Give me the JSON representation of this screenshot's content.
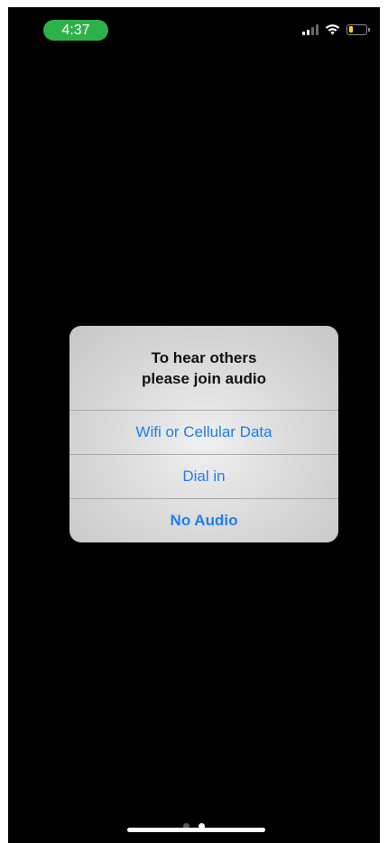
{
  "status_bar": {
    "time": "4:37",
    "icons": [
      "signal-icon",
      "wifi-icon",
      "battery-icon"
    ],
    "battery_level": 0.25,
    "colors": {
      "time_pill": "#2fb14a",
      "battery_fill": "#ffd60a"
    }
  },
  "alert": {
    "title_line1": "To hear others",
    "title_line2": "please join audio",
    "buttons": [
      {
        "label": "Wifi or Cellular Data"
      },
      {
        "label": "Dial in"
      },
      {
        "label": "No Audio"
      }
    ],
    "accent_color": "#1e7ef0"
  },
  "page_indicator": {
    "count": 2,
    "active": 2
  }
}
